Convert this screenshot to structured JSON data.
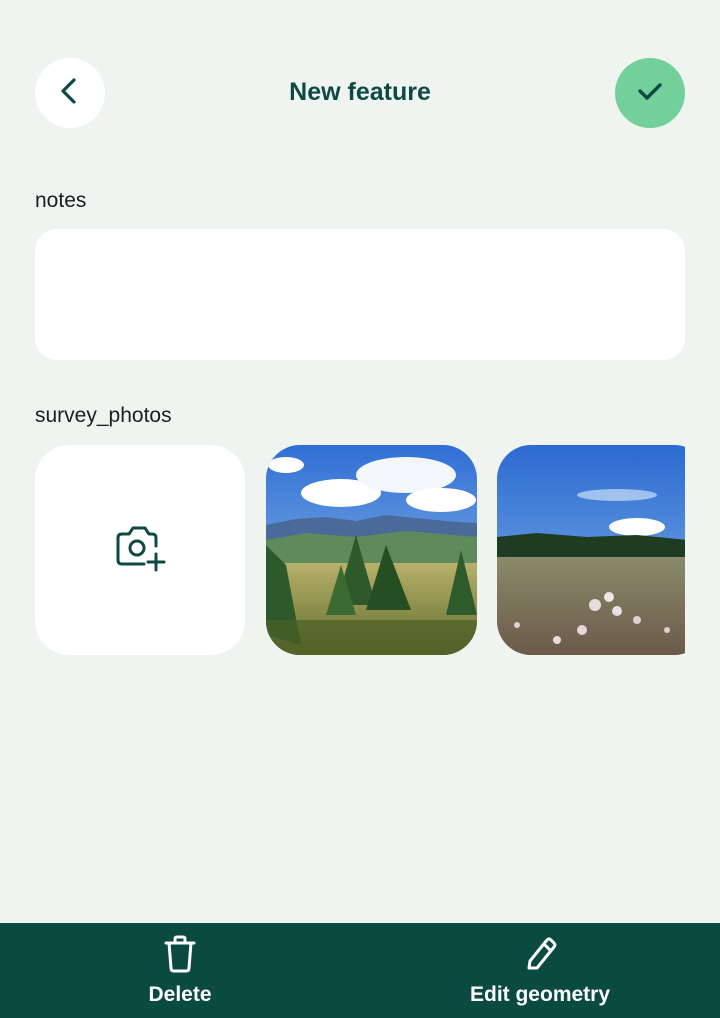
{
  "header": {
    "title": "New feature",
    "back_icon": "chevron-left-icon",
    "confirm_icon": "check-icon",
    "confirm_color": "#74d09a",
    "accent_color": "#0e4a43"
  },
  "form": {
    "notes": {
      "label": "notes",
      "value": ""
    },
    "survey_photos": {
      "label": "survey_photos",
      "add_icon": "camera-plus-icon",
      "photos": [
        {
          "description_icon": "landscape-photo-mountains"
        },
        {
          "description_icon": "landscape-photo-meadow"
        }
      ]
    }
  },
  "bottom_bar": {
    "background": "#0b4a41",
    "delete": {
      "label": "Delete",
      "icon": "trash-icon"
    },
    "edit_geometry": {
      "label": "Edit geometry",
      "icon": "pencil-icon"
    }
  }
}
